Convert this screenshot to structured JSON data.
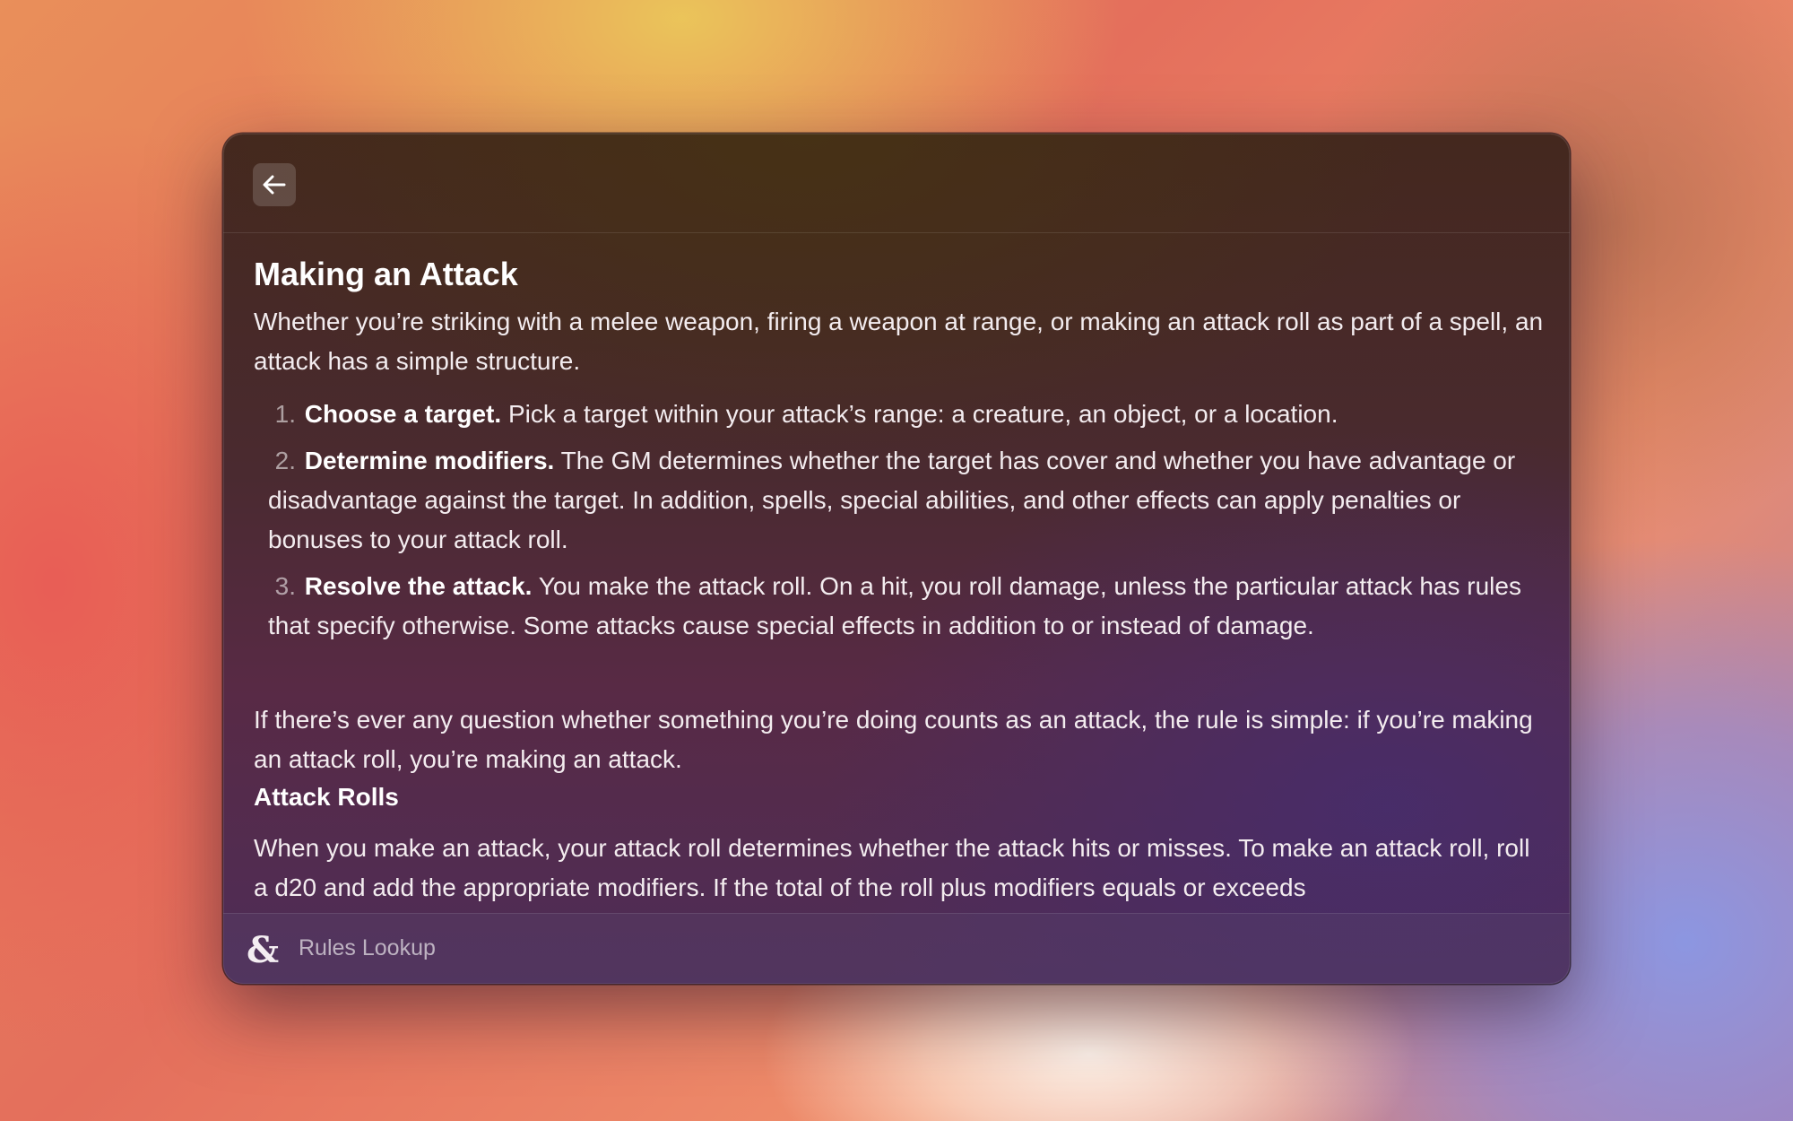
{
  "window": {
    "back_button": {
      "icon": "arrow-left-icon"
    }
  },
  "article": {
    "title": "Making an Attack",
    "intro": "Whether you’re striking with a melee weapon, firing a weapon at range, or making an attack roll as part of a spell, an attack has a simple structure.",
    "steps": [
      {
        "number": "1.",
        "title": "Choose a target.",
        "text": " Pick a target within your attack’s range: a creature, an object, or a location."
      },
      {
        "number": "2.",
        "title": "Determine modifiers.",
        "text": " The GM determines whether the target has cover and whether you have advantage or disadvantage against the target. In addition, spells, special abilities, and other effects can apply penalties or bonuses to your attack roll."
      },
      {
        "number": "3.",
        "title": "Resolve the attack.",
        "text": " You make the attack roll. On a hit, you roll damage, unless the particular attack has rules that specify otherwise. Some attacks cause special effects in addition to or instead of damage."
      }
    ],
    "outro": "If there’s ever any question whether something you’re doing counts as an attack, the rule is simple: if you’re making an attack roll, you’re making an attack.",
    "section_heading": "Attack Rolls",
    "section_text": "When you make an attack, your attack roll determines whether the attack hits or misses. To make an attack roll, roll a d20 and add the appropriate modifiers. If the total of the roll plus modifiers equals or exceeds"
  },
  "footer": {
    "logo_icon": "ampersand-dragon-icon",
    "label": "Rules Lookup"
  }
}
